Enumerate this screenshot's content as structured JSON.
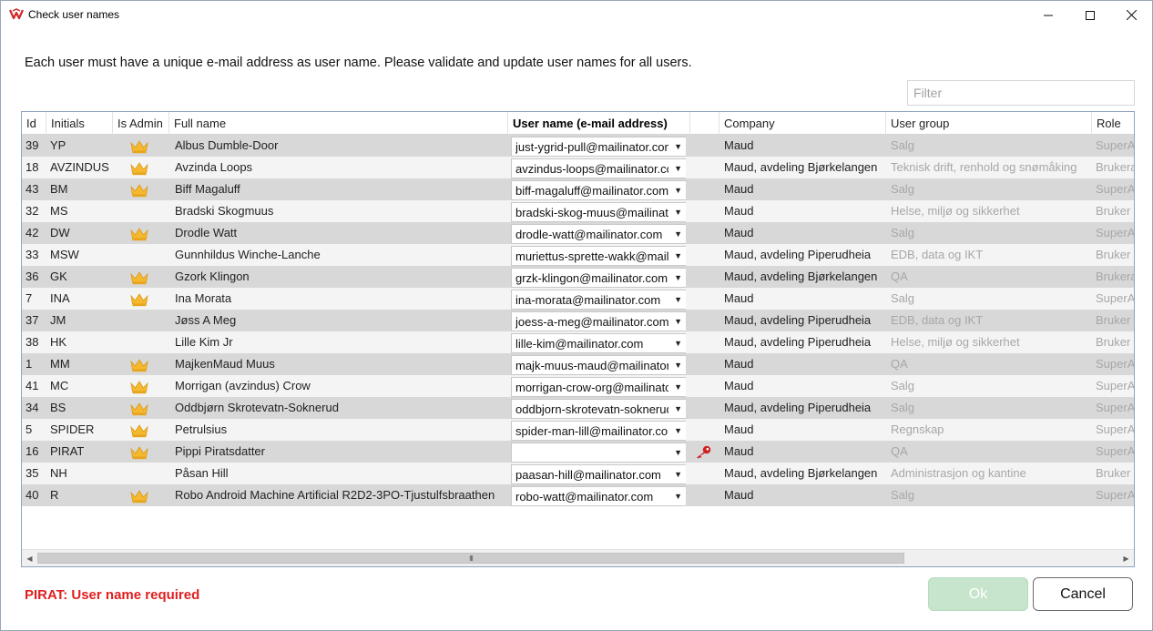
{
  "window": {
    "title": "Check user names",
    "icon": "app-logo-icon"
  },
  "intro_text": "Each user must have a unique e-mail address as user name. Please validate and update user names for all users.",
  "filter": {
    "placeholder": "Filter",
    "value": ""
  },
  "columns": {
    "id": "Id",
    "initials": "Initials",
    "is_admin": "Is Admin",
    "full_name": "Full name",
    "username": "User name (e-mail address)",
    "company": "Company",
    "user_group": "User group",
    "role": "Role"
  },
  "rows": [
    {
      "id": "39",
      "initials": "YP",
      "admin": true,
      "name": "Albus Dumble-Door",
      "username": "just-ygrid-pull@mailinator.com",
      "error_key": false,
      "company": "Maud",
      "group": "Salg",
      "role": "SuperAdmin"
    },
    {
      "id": "18",
      "initials": "AVZINDUS",
      "admin": true,
      "name": "Avzinda Loops",
      "username": "avzindus-loops@mailinator.com",
      "error_key": false,
      "company": "Maud, avdeling Bjørkelangen",
      "group": "Teknisk  drift, renhold og snømåking",
      "role": "Brukeradmin"
    },
    {
      "id": "43",
      "initials": "BM",
      "admin": true,
      "name": "Biff Magaluff",
      "username": "biff-magaluff@mailinator.com",
      "error_key": false,
      "company": "Maud",
      "group": "Salg",
      "role": "SuperAdmin"
    },
    {
      "id": "32",
      "initials": "MS",
      "admin": false,
      "name": "Bradski Skogmuus",
      "username": "bradski-skog-muus@mailinator.com",
      "error_key": false,
      "company": "Maud",
      "group": "Helse, miljø og sikkerhet",
      "role": "Bruker"
    },
    {
      "id": "42",
      "initials": "DW",
      "admin": true,
      "name": "Drodle Watt",
      "username": "drodle-watt@mailinator.com",
      "error_key": false,
      "company": "Maud",
      "group": "Salg",
      "role": "SuperAdmin"
    },
    {
      "id": "33",
      "initials": "MSW",
      "admin": false,
      "name": "Gunnhildus Winche-Lanche",
      "username": "muriettus-sprette-wakk@mailinator.com",
      "error_key": false,
      "company": "Maud, avdeling Piperudheia",
      "group": "EDB, data og IKT",
      "role": "Bruker"
    },
    {
      "id": "36",
      "initials": "GK",
      "admin": true,
      "name": "Gzork Klingon",
      "username": "grzk-klingon@mailinator.com",
      "error_key": false,
      "company": "Maud, avdeling Bjørkelangen",
      "group": "QA",
      "role": "Brukeradmin"
    },
    {
      "id": "7",
      "initials": "INA",
      "admin": true,
      "name": "Ina Morata",
      "username": "ina-morata@mailinator.com",
      "error_key": false,
      "company": "Maud",
      "group": "Salg",
      "role": "SuperAdmin"
    },
    {
      "id": "37",
      "initials": "JM",
      "admin": false,
      "name": "Jøss A Meg",
      "username": "joess-a-meg@mailinator.com",
      "error_key": false,
      "company": "Maud, avdeling Piperudheia",
      "group": "EDB, data og IKT",
      "role": "Bruker"
    },
    {
      "id": "38",
      "initials": "HK",
      "admin": false,
      "name": "Lille Kim Jr",
      "username": "lille-kim@mailinator.com",
      "error_key": false,
      "company": "Maud, avdeling Piperudheia",
      "group": "Helse, miljø og sikkerhet",
      "role": "Bruker"
    },
    {
      "id": "1",
      "initials": "MM",
      "admin": true,
      "name": "MajkenMaud Muus",
      "username": "majk-muus-maud@mailinator.com",
      "error_key": false,
      "company": "Maud",
      "group": "QA",
      "role": "SuperAdmin"
    },
    {
      "id": "41",
      "initials": "MC",
      "admin": true,
      "name": "Morrigan (avzindus) Crow",
      "username": "morrigan-crow-org@mailinator.com",
      "error_key": false,
      "company": "Maud",
      "group": "Salg",
      "role": "SuperAdmin"
    },
    {
      "id": "34",
      "initials": "BS",
      "admin": true,
      "name": "Oddbjørn Skrotevatn-Soknerud",
      "username": "oddbjorn-skrotevatn-soknerud@mailinator.com",
      "error_key": false,
      "company": "Maud, avdeling Piperudheia",
      "group": "Salg",
      "role": "SuperAdmin"
    },
    {
      "id": "5",
      "initials": "SPIDER",
      "admin": true,
      "name": "Petrulsius",
      "username": "spider-man-lill@mailinator.com",
      "error_key": false,
      "company": "Maud",
      "group": "Regnskap",
      "role": "SuperAdmin"
    },
    {
      "id": "16",
      "initials": "PIRAT",
      "admin": true,
      "name": "Pippi Piratsdatter",
      "username": "",
      "error_key": true,
      "company": "Maud",
      "group": "QA",
      "role": "SuperAdmin"
    },
    {
      "id": "35",
      "initials": "NH",
      "admin": false,
      "name": "Påsan Hill",
      "username": "paasan-hill@mailinator.com",
      "error_key": false,
      "company": "Maud, avdeling Bjørkelangen",
      "group": "Administrasjon og kantine",
      "role": "Bruker"
    },
    {
      "id": "40",
      "initials": "R",
      "admin": true,
      "name": "Robo Android Machine Artificial R2D2-3PO-Tjustulfsbraathen",
      "username": "robo-watt@mailinator.com",
      "error_key": false,
      "company": "Maud",
      "group": "Salg",
      "role": "SuperAdmin"
    }
  ],
  "scrollbar": {
    "grip": "III"
  },
  "error_message": "PIRAT: User name required",
  "buttons": {
    "ok": "Ok",
    "cancel": "Cancel"
  },
  "colors": {
    "error": "#e02020",
    "crown": "#f5b82e",
    "ok_disabled": "#c6e5cc",
    "key": "#d21f1f"
  }
}
